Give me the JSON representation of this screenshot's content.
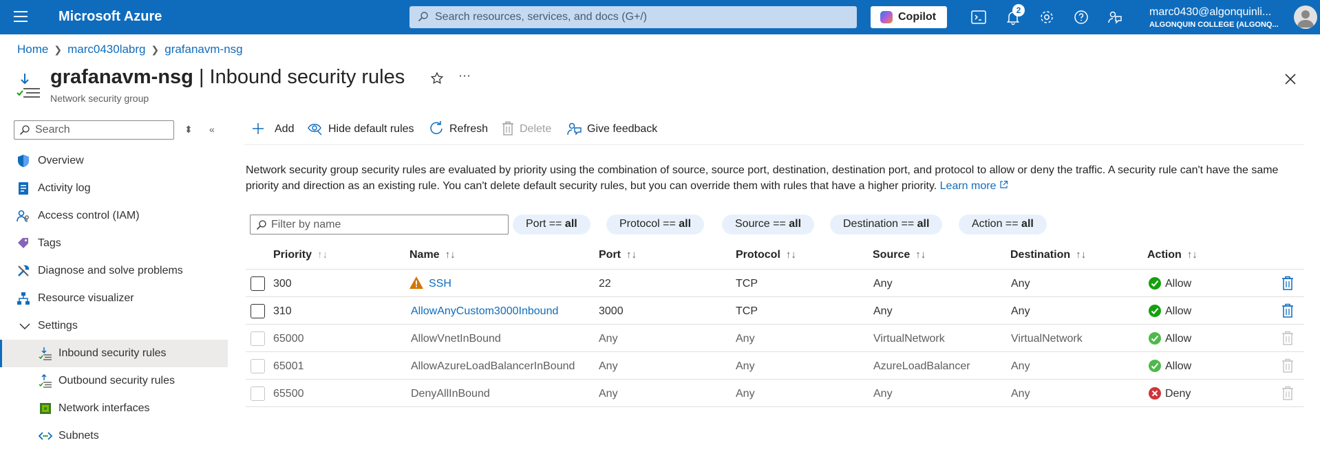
{
  "topbar": {
    "brand": "Microsoft Azure",
    "search_placeholder": "Search resources, services, and docs (G+/)",
    "copilot_label": "Copilot",
    "notification_count": "2",
    "account_name": "marc0430@algonquinli...",
    "account_org": "ALGONQUIN COLLEGE (ALGONQ...",
    "icons": [
      "menu-icon",
      "search-icon",
      "copilot-icon",
      "cloud-shell-icon",
      "notifications-icon",
      "settings-icon",
      "help-icon",
      "feedback-icon",
      "avatar"
    ]
  },
  "breadcrumb": [
    "Home",
    "marc0430labrg",
    "grafanavm-nsg"
  ],
  "header": {
    "resource_name": "grafanavm-nsg",
    "title_suffix": " | Inbound security rules",
    "subtitle": "Network security group"
  },
  "sidebar": {
    "search_placeholder": "Search",
    "items": [
      {
        "label": "Overview",
        "icon": "shield-icon"
      },
      {
        "label": "Activity log",
        "icon": "activity-log-icon"
      },
      {
        "label": "Access control (IAM)",
        "icon": "iam-icon"
      },
      {
        "label": "Tags",
        "icon": "tag-icon"
      },
      {
        "label": "Diagnose and solve problems",
        "icon": "wrench-icon"
      },
      {
        "label": "Resource visualizer",
        "icon": "visualizer-icon"
      },
      {
        "label": "Settings",
        "icon": "chevron-down-icon"
      },
      {
        "label": "Inbound security rules",
        "icon": "inbound-rules-icon"
      },
      {
        "label": "Outbound security rules",
        "icon": "outbound-rules-icon"
      },
      {
        "label": "Network interfaces",
        "icon": "network-interface-icon"
      },
      {
        "label": "Subnets",
        "icon": "subnet-icon"
      }
    ]
  },
  "toolbar": {
    "add": "Add",
    "hide_default": "Hide default rules",
    "refresh": "Refresh",
    "delete": "Delete",
    "feedback": "Give feedback"
  },
  "description": {
    "text": "Network security group security rules are evaluated by priority using the combination of source, source port, destination, destination port, and protocol to allow or deny the traffic. A security rule can't have the same priority and direction as an existing rule. You can't delete default security rules, but you can override them with rules that have a higher priority.",
    "link": "Learn more"
  },
  "filters": {
    "placeholder": "Filter by name",
    "pills": [
      {
        "key": "Port == ",
        "value": "all"
      },
      {
        "key": "Protocol == ",
        "value": "all"
      },
      {
        "key": "Source == ",
        "value": "all"
      },
      {
        "key": "Destination == ",
        "value": "all"
      },
      {
        "key": "Action == ",
        "value": "all"
      }
    ]
  },
  "table": {
    "columns": [
      "Priority",
      "Name",
      "Port",
      "Protocol",
      "Source",
      "Destination",
      "Action"
    ],
    "rows": [
      {
        "priority": "300",
        "name": "SSH",
        "port": "22",
        "protocol": "TCP",
        "source": "Any",
        "destination": "Any",
        "action": "Allow",
        "custom": true,
        "warning": true
      },
      {
        "priority": "310",
        "name": "AllowAnyCustom3000Inbound",
        "port": "3000",
        "protocol": "TCP",
        "source": "Any",
        "destination": "Any",
        "action": "Allow",
        "custom": true,
        "warning": false
      },
      {
        "priority": "65000",
        "name": "AllowVnetInBound",
        "port": "Any",
        "protocol": "Any",
        "source": "VirtualNetwork",
        "destination": "VirtualNetwork",
        "action": "Allow",
        "custom": false,
        "warning": false
      },
      {
        "priority": "65001",
        "name": "AllowAzureLoadBalancerInBound",
        "port": "Any",
        "protocol": "Any",
        "source": "AzureLoadBalancer",
        "destination": "Any",
        "action": "Allow",
        "custom": false,
        "warning": false
      },
      {
        "priority": "65500",
        "name": "DenyAllInBound",
        "port": "Any",
        "protocol": "Any",
        "source": "Any",
        "destination": "Any",
        "action": "Deny",
        "custom": false,
        "warning": false
      }
    ]
  },
  "colors": {
    "azure_blue": "#0f6cbd",
    "allow_green": "#13a10e",
    "deny_red": "#d13438",
    "warning_orange": "#d47500"
  }
}
